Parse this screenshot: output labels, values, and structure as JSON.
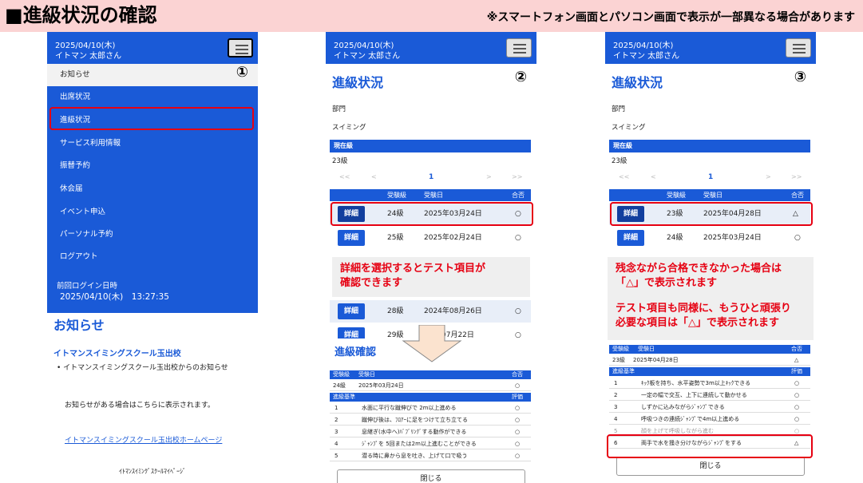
{
  "banner": {
    "title": "■進級状況の確認",
    "note": "※スマートフォン画面とパソコン画面で表示が一部異なる場合があります"
  },
  "header": {
    "date": "2025/04/10(木)",
    "user": "イトマン 太郎さん"
  },
  "panel1": {
    "num": "①",
    "menu": [
      "お知らせ",
      "出席状況",
      "進級状況",
      "サービス利用情報",
      "振替予約",
      "休会届",
      "イベント申込",
      "パーソナル予約",
      "ログアウト"
    ],
    "last_login_label": "前回ログイン日時",
    "last_login_value": "2025/04/10(木)　13:27:35",
    "news_title": "お知らせ",
    "school": "イトマンスイミングスクール玉出校",
    "bullet": "•  イトマンスイミングスクール玉出校からのお知らせ",
    "info": "お知らせがある場合はこちらに表示されます。",
    "link": "イトマンスイミングスクール玉出校ホームページ",
    "footer": "ｲﾄﾏﾝｽｲﾐﾝｸﾞｽｸｰﾙﾏｲﾍﾟｰｼﾞ"
  },
  "status": {
    "title": "進級状況",
    "dept_label": "部門",
    "dept_value": "スイミング",
    "current_label": "現在級",
    "current_value": "23級",
    "pager": [
      "<<",
      "<",
      "1",
      ">",
      ">>"
    ],
    "cols": [
      "受験級",
      "受験日",
      "合否"
    ],
    "detail": "詳細",
    "close": "閉じる"
  },
  "panel2": {
    "num": "②",
    "rows": [
      {
        "grade": "24級",
        "date": "2025年03月24日",
        "result": "○"
      },
      {
        "grade": "25級",
        "date": "2025年02月24日",
        "result": "○"
      },
      {
        "grade": "28級",
        "date": "2024年08月26日",
        "result": "○"
      },
      {
        "grade": "29級",
        "date": "07月22日",
        "result": "○"
      }
    ],
    "callout": [
      "詳細を選択するとテスト項目が",
      "確認できます"
    ],
    "sub_title": "進級確認",
    "sub_head": [
      "受験級",
      "受験日",
      "合否"
    ],
    "sub_row": {
      "grade": "24級",
      "date": "2025年03月24日",
      "result": "○"
    },
    "crit_head": [
      "進級基準",
      "評価"
    ],
    "crit": [
      {
        "n": "1",
        "text": "水面に平行な蹴伸びで 2m以上進める",
        "r": "○"
      },
      {
        "n": "2",
        "text": "蹴伸び後は、ﾌﾛｱｰに足をつけて立ち立てる",
        "r": "○"
      },
      {
        "n": "3",
        "text": "息継ぎ(水中へ)ﾊﾞﾌﾞﾘﾝｸﾞする動作ができる",
        "r": "○"
      },
      {
        "n": "4",
        "text": "ｼﾞｬﾝﾌﾟを 5回または2m以上進むことができる",
        "r": "○"
      },
      {
        "n": "5",
        "text": "潜る時に鼻から息を吐き、上げて口で吸う",
        "r": "○"
      }
    ]
  },
  "panel3": {
    "num": "③",
    "rows": [
      {
        "grade": "23級",
        "date": "2025年04月28日",
        "result": "△"
      },
      {
        "grade": "24級",
        "date": "2025年03月24日",
        "result": "○"
      }
    ],
    "callout": [
      "残念ながら合格できなかった場合は",
      "「△」で表示されます",
      "",
      "テスト項目も同様に、もうひと頑張り",
      "必要な項目は「△」で表示されます"
    ],
    "sub_head": [
      "受験級",
      "受験日",
      "合否"
    ],
    "sub_row": {
      "grade": "23級",
      "date": "2025年04月28日",
      "result": "△"
    },
    "crit_head": [
      "進級基準",
      "評価"
    ],
    "crit": [
      {
        "n": "1",
        "text": "ｷｯｸ板を持ち、水平姿勢で3m以上ｷｯｸできる",
        "r": "○"
      },
      {
        "n": "2",
        "text": "一定の幅で交互、上下に連続して動かせる",
        "r": "○"
      },
      {
        "n": "3",
        "text": "しずかに込みながらｼﾞｬﾝﾌﾟできる",
        "r": "○"
      },
      {
        "n": "4",
        "text": "呼吸つきの連続ｼﾞｬﾝﾌﾟで4m以上進める",
        "r": "○"
      },
      {
        "n": "5",
        "text": "顔を上げて呼吸しながら進む",
        "r": "○"
      },
      {
        "n": "6",
        "text": "両手で水を掻き分けながらｼﾞｬﾝﾌﾟをする",
        "r": "△"
      }
    ]
  },
  "colors": {
    "primary": "#1a5ad7",
    "highlight": "#e60012",
    "banner": "#fbd3d3"
  }
}
